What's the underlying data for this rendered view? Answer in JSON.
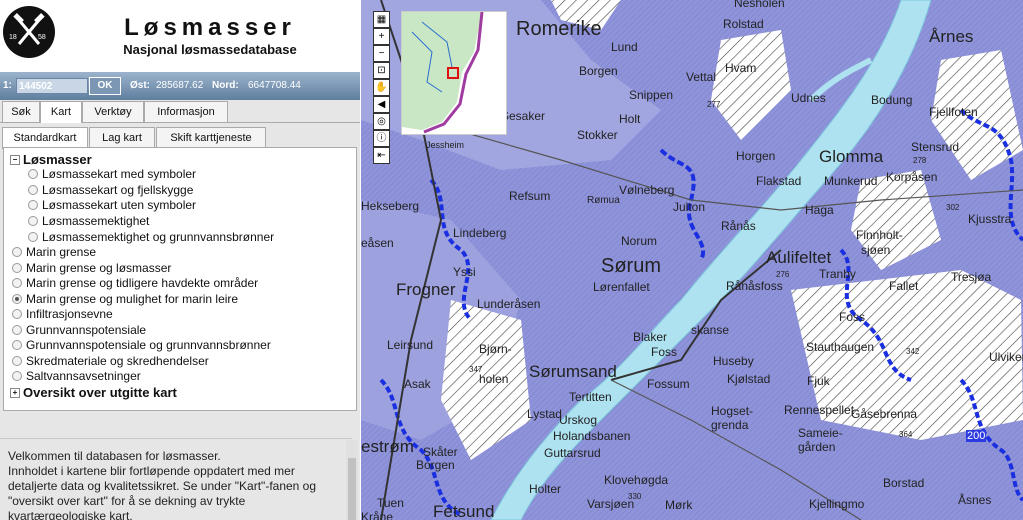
{
  "header": {
    "title": "Løsmasser",
    "subtitle": "Nasjonal løsmassedatabase",
    "logo_left_number": "18",
    "logo_right_number": "58"
  },
  "coordbar": {
    "scale_label": "1:",
    "scale_value": "144502",
    "ok_label": "OK",
    "east_label": "Øst:",
    "east_value": "285687.62",
    "north_label": "Nord:",
    "north_value": "6647708.44"
  },
  "main_tabs": [
    "Søk",
    "Kart",
    "Verktøy",
    "Informasjon"
  ],
  "sub_tabs": [
    "Standardkart",
    "Lag kart",
    "Skift karttjeneste"
  ],
  "tree": {
    "group1": "Løsmasser",
    "group1_items": [
      "Løsmassekart med symboler",
      "Løsmassekart og fjellskygge",
      "Løsmassekart uten symboler",
      "Løsmassemektighet",
      "Løsmassemektighet og grunnvannsbrønner"
    ],
    "items": [
      "Marin grense",
      "Marin grense og løsmasser",
      "Marin grense og tidligere havdekte områder",
      "Marin grense og mulighet for marin leire",
      "Infiltrasjonsevne",
      "Grunnvannspotensiale",
      "Grunnvannspotensiale og grunnvannsbrønner",
      "Skredmateriale og skredhendelser",
      "Saltvannsavsetninger"
    ],
    "selected_item": "Marin grense og mulighet for marin leire",
    "group2": "Oversikt over utgitte kart"
  },
  "info": {
    "line1": "Velkommen til databasen for løsmasser.",
    "line2": "Innholdet i kartene blir fortløpende oppdatert med mer",
    "line3": "detaljerte data og kvalitetssikret. Se under \"Kart\"-fanen og",
    "line4": "\"oversikt over kart\" for å se dekning av trykte",
    "line5": "kvartærgeologiske kart."
  },
  "map_tools": [
    "layers-icon",
    "zoom-in-icon",
    "zoom-out-icon",
    "zoom-box-icon",
    "pan-icon",
    "back-icon",
    "full-extent-icon",
    "info-icon",
    "collapse-icon"
  ],
  "map": {
    "places_big": [
      "Romerike",
      "Sørum",
      "Aulifeltet",
      "Glomma",
      "Frogner",
      "Sørumsand",
      "Årnes",
      "Fetsund",
      "estrøm"
    ],
    "places_small": [
      "Nesholen",
      "Rolstad",
      "Lund",
      "Borgen",
      "Vettal",
      "Hvam",
      "Snippen",
      "Udnes",
      "Bodung",
      "Fjellfoten",
      "Stokker",
      "Holt",
      "Horgen",
      "Stensrud",
      "Flakstad",
      "Munkerud",
      "Korpåsen",
      "Refsum",
      "Vølneberg",
      "Julton",
      "Haga",
      "Finnholt-",
      "sjøen",
      "Kjusstra",
      "Hekseberg",
      "Lindeberg",
      "Rånås",
      "Norum",
      "Tranby",
      "Fallet",
      "Tresjøa",
      "Lørenfallet",
      "Rånåsfoss",
      "Yssi",
      "Lunderåsen",
      "Blaker",
      "skanse",
      "Foss",
      "Stauthaugen",
      "Ulviken",
      "Leirsund",
      "Bjørn-",
      "holen",
      "Foss",
      "Huseby",
      "Kjølstad",
      "Fjuk",
      "Asak",
      "Fossum",
      "Hogset-",
      "grenda",
      "Rennespellet",
      "Gåsebrenna",
      "Tertitten",
      "Lystad",
      "Urskog",
      "Holandsbanen",
      "Sameie-",
      "gården",
      "Skåter",
      "Borgen",
      "Guttarsrud",
      "Klovehøgda",
      "Borstad",
      "Holter",
      "Varsjøen",
      "Mørk",
      "Kjellingmo",
      "Åsnes",
      "Tuen",
      "Kråne",
      "Sesaker",
      "Rømua",
      "Jessheim",
      "eåsen"
    ],
    "numbers": [
      "277",
      "278",
      "302",
      "276",
      "342",
      "364",
      "347",
      "330",
      "200"
    ]
  }
}
